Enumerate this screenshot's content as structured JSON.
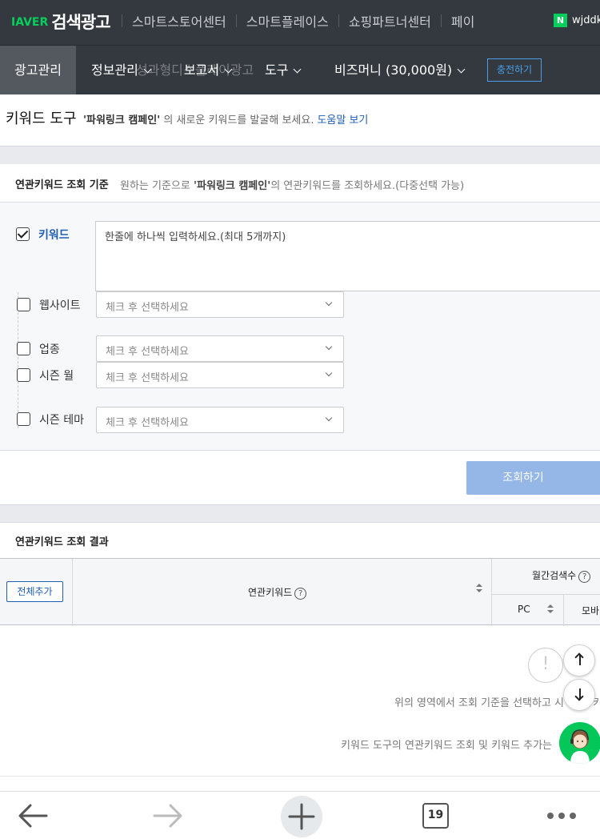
{
  "header": {
    "logo_prefix": "IAVER",
    "logo_text": "검색광고",
    "nav": [
      "스마트스토어센터",
      "스마트플레이스",
      "쇼핑파트너센터",
      "페이"
    ],
    "user_badge": "N",
    "user_name": "wjddk"
  },
  "menubar": {
    "active": "광고관리",
    "items": [
      "정보관리",
      "보고서",
      "도구",
      "비즈머니 (30,000원)"
    ],
    "ghost_text": "성과형디스플레이광고",
    "charge_button": "충전하기"
  },
  "page": {
    "title": "키워드 도구",
    "desc_campaign": "'파워링크 캠페인'",
    "desc_text": " 의 새로운 키워드를 발굴해 보세요.",
    "help_link": "도움말 보기"
  },
  "criteria": {
    "title": "연관키워드 조회 기준",
    "subtitle_pre": "원하는 기준으로 ",
    "subtitle_campaign": "'파워링크 캠페인'",
    "subtitle_post": "의 연관키워드를 조회하세요.(다중선택 가능)",
    "keyword_label": "키워드",
    "keyword_placeholder": "한줄에 하나씩 입력하세요.(최대 5개까지)",
    "options": [
      {
        "label": "웹사이트",
        "placeholder": "체크 후 선택하세요"
      },
      {
        "label": "업종",
        "placeholder": "체크 후 선택하세요"
      },
      {
        "label": "시즌 월",
        "placeholder": "체크 후 선택하세요"
      },
      {
        "label": "시즌 테마",
        "placeholder": "체크 후 선택하세요"
      }
    ],
    "search_button": "조회하기"
  },
  "results": {
    "title": "연관키워드 조회 결과",
    "add_all": "전체추가",
    "col_keyword": "연관키워드",
    "col_monthly": "월간검색수",
    "col_pc": "PC",
    "col_mobile": "모바",
    "help_mark": "?",
    "empty_icon": "!",
    "empty_line1": "위의 영역에서 조회 기준을 선택하고 시",
    "empty_line1_tail": "키",
    "empty_line2": "키워드 도구의 연관키워드 조회 및 키워드 추가는"
  },
  "browser": {
    "tab_count": "19"
  }
}
